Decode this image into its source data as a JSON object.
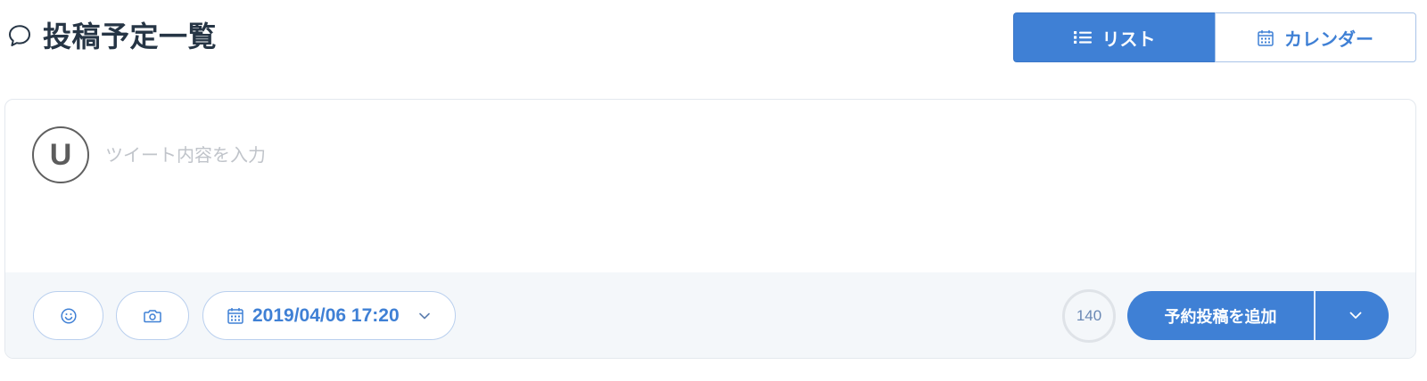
{
  "header": {
    "title_icon": "speech-bubble-icon",
    "title": "投稿予定一覧"
  },
  "view_toggle": {
    "selected": "list",
    "list": {
      "label": "リスト",
      "icon": "list-icon"
    },
    "calendar": {
      "label": "カレンダー",
      "icon": "calendar-icon"
    }
  },
  "composer": {
    "avatar_letter": "U",
    "tweet_input": {
      "value": "",
      "placeholder": "ツイート内容を入力"
    },
    "emoji_button": {
      "icon": "smile-icon"
    },
    "media_button": {
      "icon": "camera-icon"
    },
    "schedule": {
      "icon": "calendar-icon",
      "value": "2019/04/06 17:20",
      "dropdown_icon": "chevron-down-icon"
    },
    "remaining_chars": "140",
    "submit": {
      "label": "予約投稿を追加",
      "menu_icon": "chevron-down-icon"
    }
  },
  "colors": {
    "accent": "#3f80d5",
    "title_text": "#263545",
    "placeholder": "#c0c4ca",
    "counter_text": "#6a88b4",
    "footer_background": "#f4f7fa"
  }
}
